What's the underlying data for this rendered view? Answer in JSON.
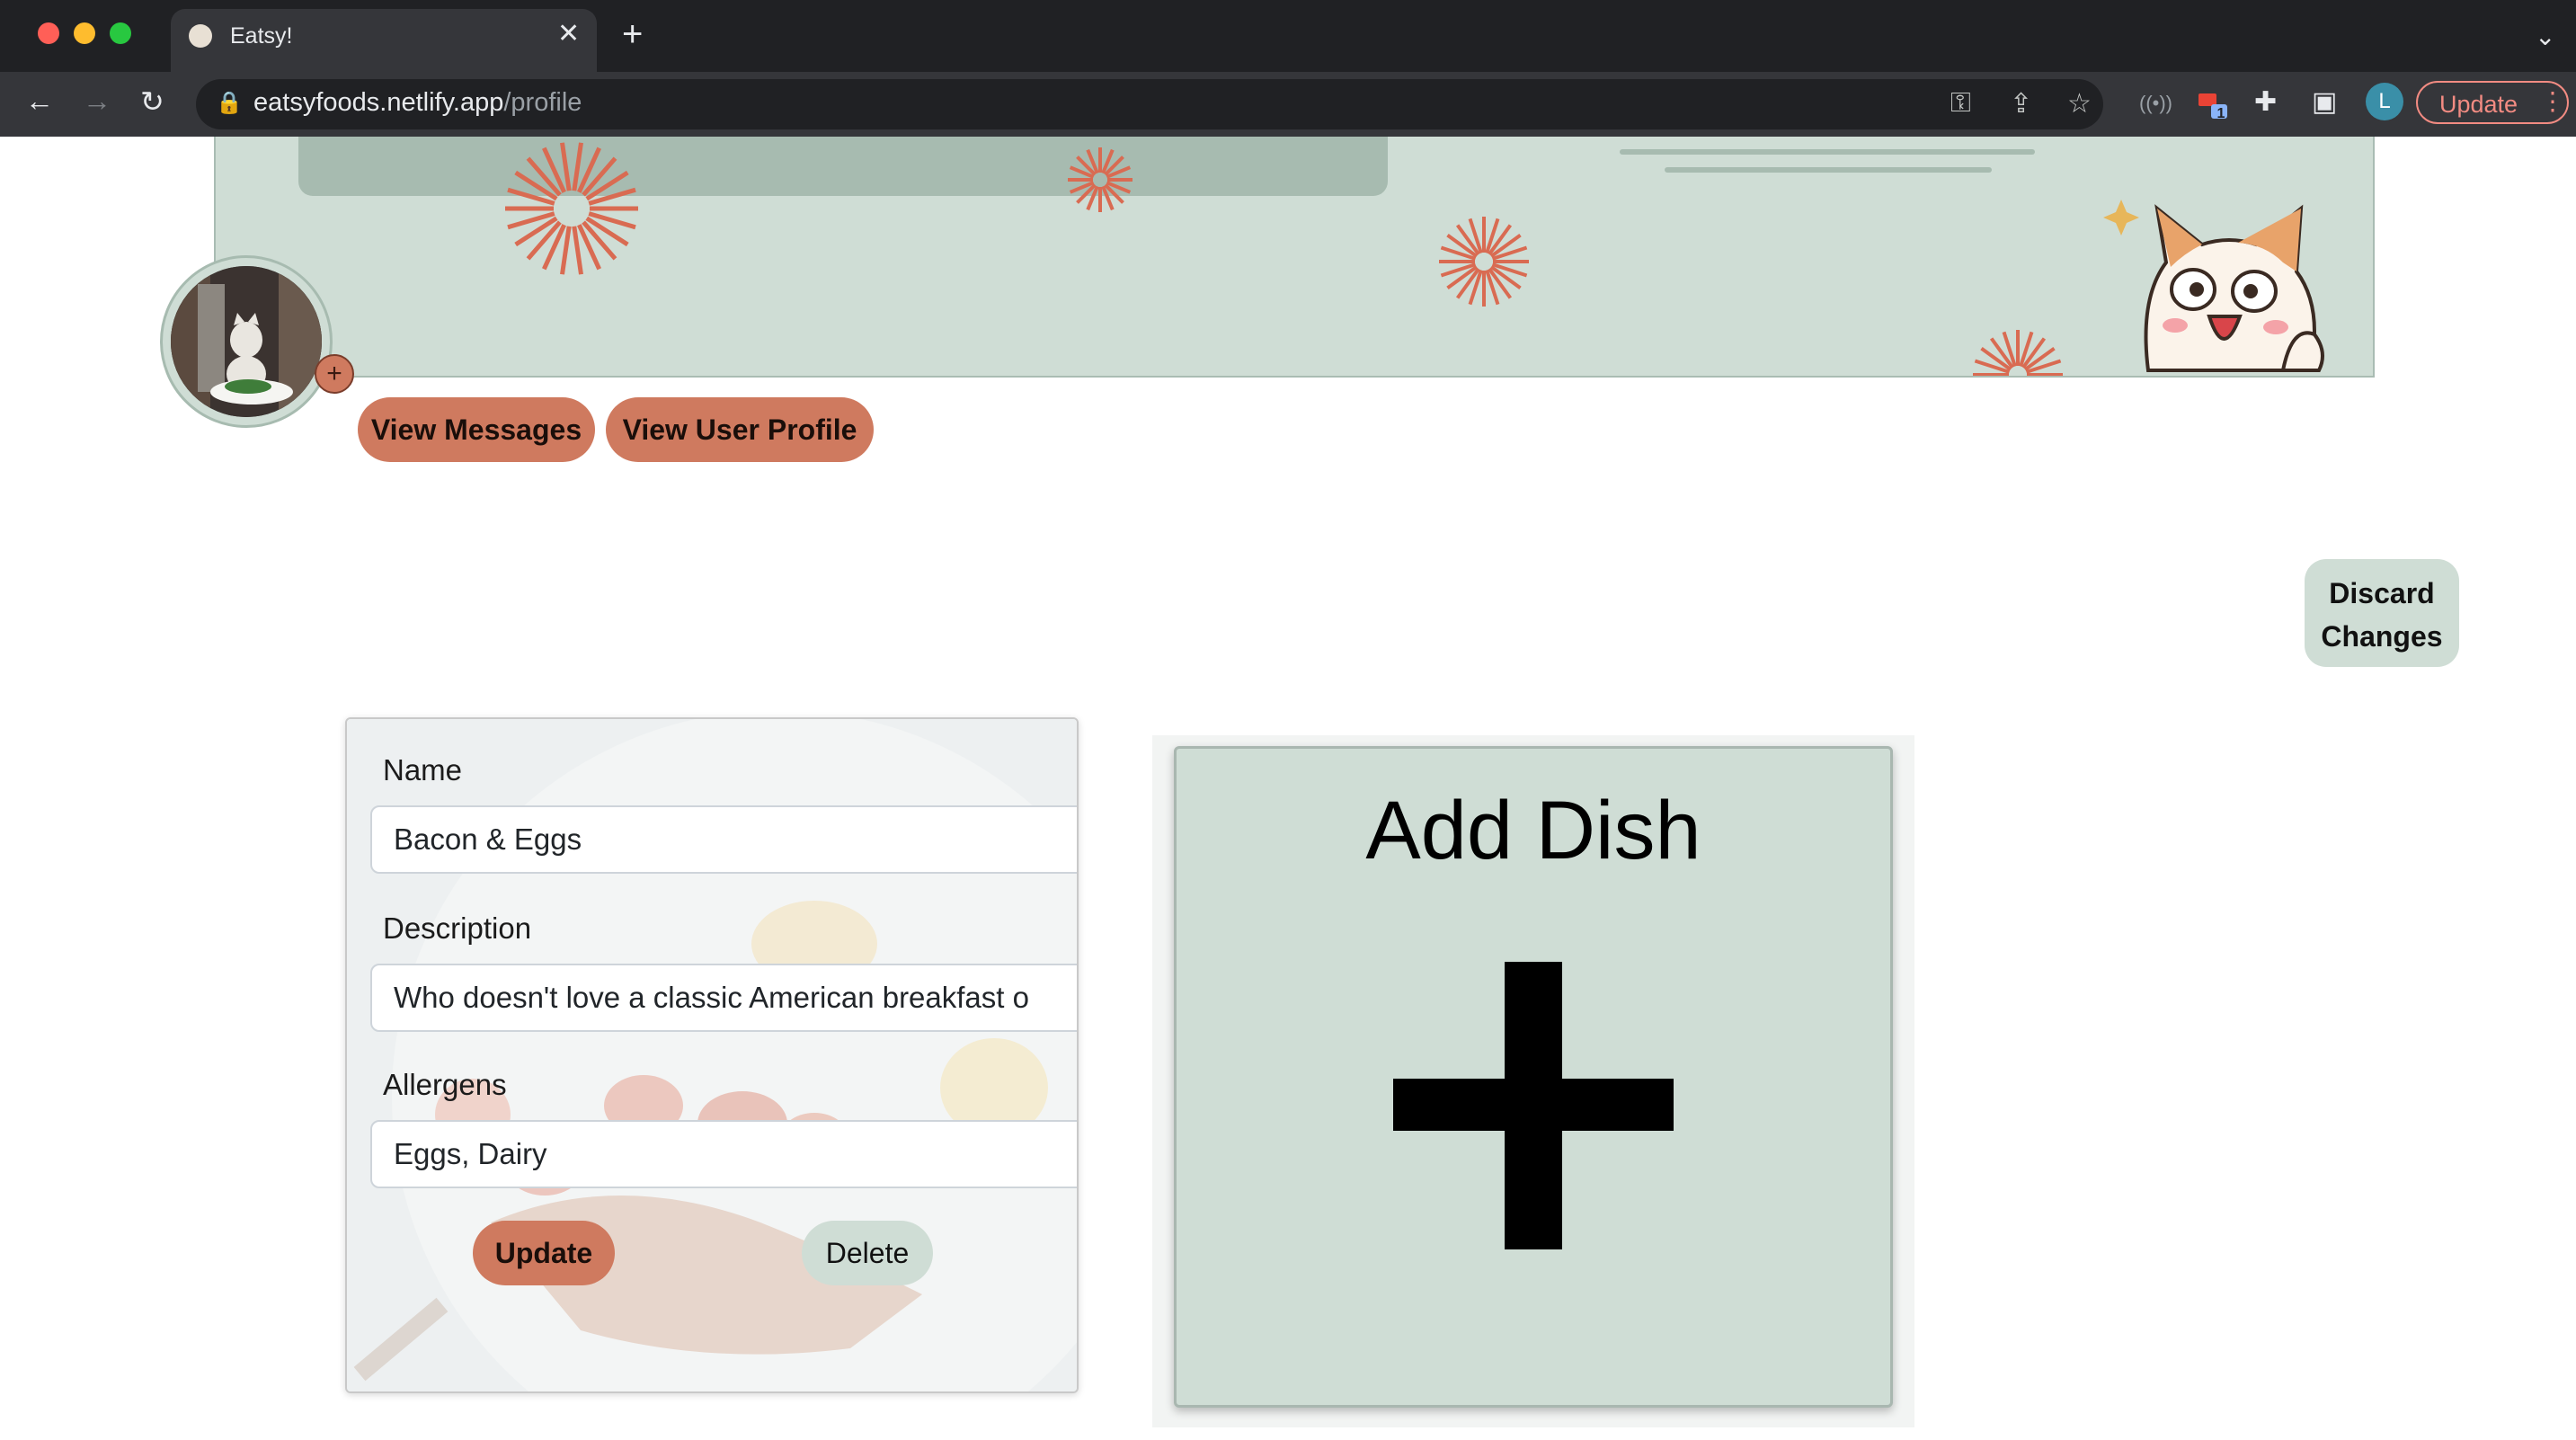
{
  "browser": {
    "tab_title": "Eatsy!",
    "url_host": "eatsyfoods.netlify.app",
    "url_path": "/profile",
    "profile_initial": "L",
    "update_label": "Update",
    "extension_badge": "1"
  },
  "profile": {
    "view_messages_label": "View Messages",
    "view_user_profile_label": "View User Profile",
    "add_photo_symbol": "+",
    "discard_line1": "Discard",
    "discard_line2": "Changes"
  },
  "dish": {
    "name_label": "Name",
    "name_value": "Bacon & Eggs",
    "description_label": "Description",
    "description_value": "Who doesn't love a classic American breakfast o",
    "allergens_label": "Allergens",
    "allergens_value": "Eggs, Dairy",
    "update_label": "Update",
    "delete_label": "Delete"
  },
  "add_dish": {
    "title": "Add Dish"
  },
  "colors": {
    "accent": "#cf7a5f",
    "sage": "#cfddd5",
    "sage_dark": "#a7bbb0",
    "chrome_dark": "#202124"
  }
}
